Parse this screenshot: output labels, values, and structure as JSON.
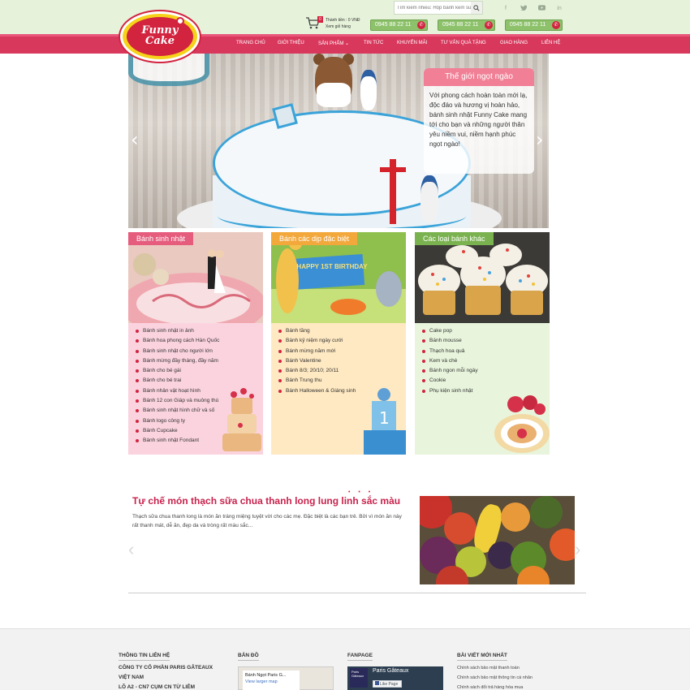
{
  "header": {
    "logo_line1": "Funny",
    "logo_line2": "Cake",
    "search_placeholder": "Tìm kiếm nhiều: Hộp bánh kem sữa",
    "cart_count": "0",
    "cart_total": "Thành tiền : 0 VNĐ",
    "cart_view": "Xem giỏ hàng",
    "hotlines": [
      "0945 88 22 11",
      "0945 88 22 11",
      "0945 88 22 11"
    ],
    "social_icons": [
      "facebook-icon",
      "twitter-icon",
      "youtube-icon",
      "linkedin-icon"
    ]
  },
  "nav": {
    "items": [
      "TRANG CHỦ",
      "GIỚI THIỆU",
      "SẢN PHẨM",
      "TIN TỨC",
      "KHUYẾN MÃI",
      "TƯ VẤN QUÀ TẶNG",
      "GIAO HÀNG",
      "LIÊN HỆ"
    ],
    "dropdown_glyph": "⌄"
  },
  "hero": {
    "caption_title": "Thế giới ngọt ngào",
    "caption_body": "Với phong cách hoàn toàn mới lạ, độc đáo và hương vị hoàn hảo, bánh sinh nhật Funny Cake mang tới cho bạn và những người thân yêu niềm vui, niềm hạnh phúc ngọt ngào!",
    "prev_glyph": "‹",
    "next_glyph": "›"
  },
  "cards": [
    {
      "title": "Bánh sinh nhật",
      "bg": "#fbd3df",
      "title_bg": "#e55c7d",
      "items": [
        "Bánh sinh nhật in ảnh",
        "Bánh hoa phong cách Hàn Quốc",
        "Bánh sinh nhật cho người lớn",
        "Bánh mừng đầy tháng, đầy năm",
        "Bánh cho bé gái",
        "Bánh cho bé trai",
        "Bánh nhân vật hoạt hình",
        "Bánh 12 con Giáp và muông thú",
        "Bánh sinh nhật hình chữ và số",
        "Bánh logo công ty",
        "Bánh Cupcake",
        "Bánh sinh nhật Fondant"
      ]
    },
    {
      "title": "Bánh các dịp đặc biệt",
      "bg": "#ffe9c2",
      "title_bg": "#f2a83b",
      "items": [
        "Bánh tầng",
        "Bánh kỷ niệm ngày cưới",
        "Bánh mừng năm mới",
        "Bánh Valentine",
        "Bánh 8/3; 20/10; 20/11",
        "Bánh Trung thu",
        "Bánh Halloween & Giáng sinh"
      ]
    },
    {
      "title": "Các loại bánh khác",
      "bg": "#e8f5dc",
      "title_bg": "#7ab24f",
      "items": [
        "Cake pop",
        "Bánh mousse",
        "Thạch hoa quả",
        "Kem và chè",
        "Bánh ngon mỗi ngày",
        "Cookie",
        "Phụ kiện sinh nhật"
      ]
    }
  ],
  "birthday_topper": "HAPPY 1ST BIRTHDAY",
  "news": {
    "title": "Tự chế món thạch sữa chua thanh long lung linh sắc màu",
    "desc": "Thạch sữa chua thanh long là món ăn tráng miệng tuyệt vời cho các mẹ. Đặc biệt là các bạn trẻ. Bởi vì món ăn này rất thanh mát, dễ ăn, đẹp da và tròng rất màu sắc...",
    "dots": "• • •",
    "prev_glyph": "‹",
    "next_glyph": "›"
  },
  "footer": {
    "contact_title": "THÔNG TIN LIÊN HỆ",
    "company_line1": "CÔNG TY CỔ PHẦN PARIS GÂTEAUX",
    "company_line2": "VIỆT NAM",
    "company_line3": "LÔ A2 - CN7 CỤM CN TỪ LIÊM",
    "map_title": "BẢN ĐỒ",
    "map_place": "Bánh Ngọt Paris G...",
    "map_link": "View larger map",
    "fanpage_title": "FANPAGE",
    "fanpage_name": "Paris Gâteaux",
    "fanpage_thumb": "Paris Gâteaux",
    "fanpage_like": "Like Page",
    "posts_title": "BÀI VIẾT MỚI NHẤT",
    "posts": [
      "Chính sách bảo mật thanh toán",
      "Chính sách bảo mật thông tin cá nhân",
      "Chính sách đổi trả hàng hóa mua"
    ]
  }
}
